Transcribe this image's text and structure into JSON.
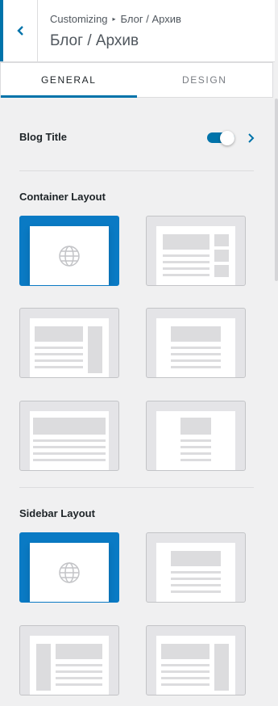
{
  "header": {
    "breadcrumb_root": "Customizing",
    "breadcrumb_separator": "▸",
    "breadcrumb_current": "Блог / Архив",
    "title": "Блог / Архив"
  },
  "tabs": [
    {
      "label": "GENERAL",
      "active": true
    },
    {
      "label": "DESIGN",
      "active": false
    }
  ],
  "blog_title": {
    "label": "Blog Title",
    "toggle_on": true
  },
  "container_layout": {
    "label": "Container Layout",
    "options": [
      {
        "name": "default",
        "selected": true,
        "icon": "globe-icon"
      },
      {
        "name": "content-with-right-sidebar-boxes",
        "selected": false
      },
      {
        "name": "content-right-sidebar",
        "selected": false
      },
      {
        "name": "boxed-content",
        "selected": false
      },
      {
        "name": "full-width",
        "selected": false
      },
      {
        "name": "narrow-centered",
        "selected": false
      }
    ]
  },
  "sidebar_layout": {
    "label": "Sidebar Layout",
    "options": [
      {
        "name": "default",
        "selected": true,
        "icon": "globe-icon"
      },
      {
        "name": "no-sidebar",
        "selected": false
      },
      {
        "name": "left-sidebar",
        "selected": false
      },
      {
        "name": "right-sidebar",
        "selected": false
      }
    ]
  },
  "colors": {
    "accent": "#0073aa",
    "selected_tile": "#0a7ac4",
    "panel_bg": "#f0f0f1"
  }
}
